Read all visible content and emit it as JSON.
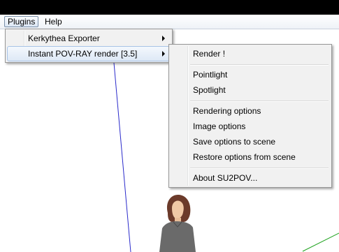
{
  "menubar": {
    "plugins_label": "Plugins",
    "help_label": "Help"
  },
  "plugins_menu": {
    "items": [
      {
        "label": "Kerkythea Exporter",
        "has_submenu": true
      },
      {
        "label": "Instant POV-RAY render [3.5]",
        "has_submenu": true,
        "highlighted": true
      }
    ]
  },
  "povray_submenu": {
    "items": [
      "Render !",
      "Pointlight",
      "Spotlight",
      "Rendering options",
      "Image options",
      "Save options to scene",
      "Restore options from scene",
      "About SU2POV..."
    ]
  },
  "colors": {
    "axis_blue": "#2a2acb",
    "axis_green": "#21a321",
    "menu_highlight_border": "#a8c3e6"
  },
  "icons": [
    "submenu-arrow-icon"
  ]
}
